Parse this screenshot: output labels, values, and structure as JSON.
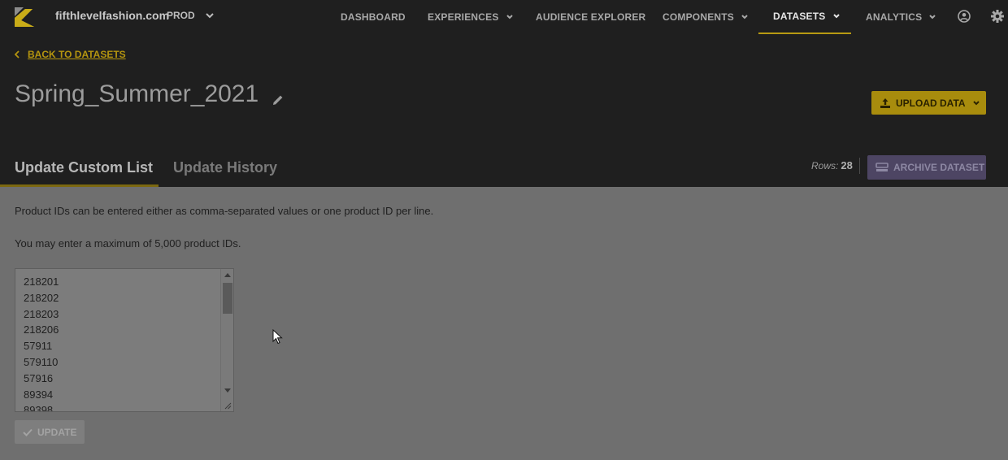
{
  "nav": {
    "site_name": "fifthlevelfashion.com",
    "env": "PROD",
    "items": [
      {
        "label": "DASHBOARD",
        "dropdown": false
      },
      {
        "label": "EXPERIENCES",
        "dropdown": true
      },
      {
        "label": "AUDIENCE EXPLORER",
        "dropdown": false
      },
      {
        "label": "COMPONENTS",
        "dropdown": true
      },
      {
        "label": "DATASETS",
        "dropdown": true,
        "active": true
      },
      {
        "label": "ANALYTICS",
        "dropdown": true
      }
    ],
    "icons": [
      "user-circle-icon",
      "gear-icon"
    ],
    "accent_color": "#b89a12"
  },
  "header": {
    "back_label": "BACK TO DATASETS",
    "title": "Spring_Summer_2021",
    "upload_label": "UPLOAD DATA",
    "tabs": [
      {
        "label": "Update Custom List",
        "active": true
      },
      {
        "label": "Update History",
        "active": false
      }
    ],
    "rows_label": "Rows:",
    "rows_count": "28",
    "archive_label": "ARCHIVE DATASET"
  },
  "main": {
    "help_1": "Product IDs can be entered either as comma-separated values or one product ID per line.",
    "help_2": "You may enter a maximum of 5,000 product IDs.",
    "ids": [
      "218201",
      "218202",
      "218203",
      "218206",
      "57911",
      "579110",
      "57916",
      "89394",
      "89398"
    ],
    "update_label": "UPDATE"
  }
}
